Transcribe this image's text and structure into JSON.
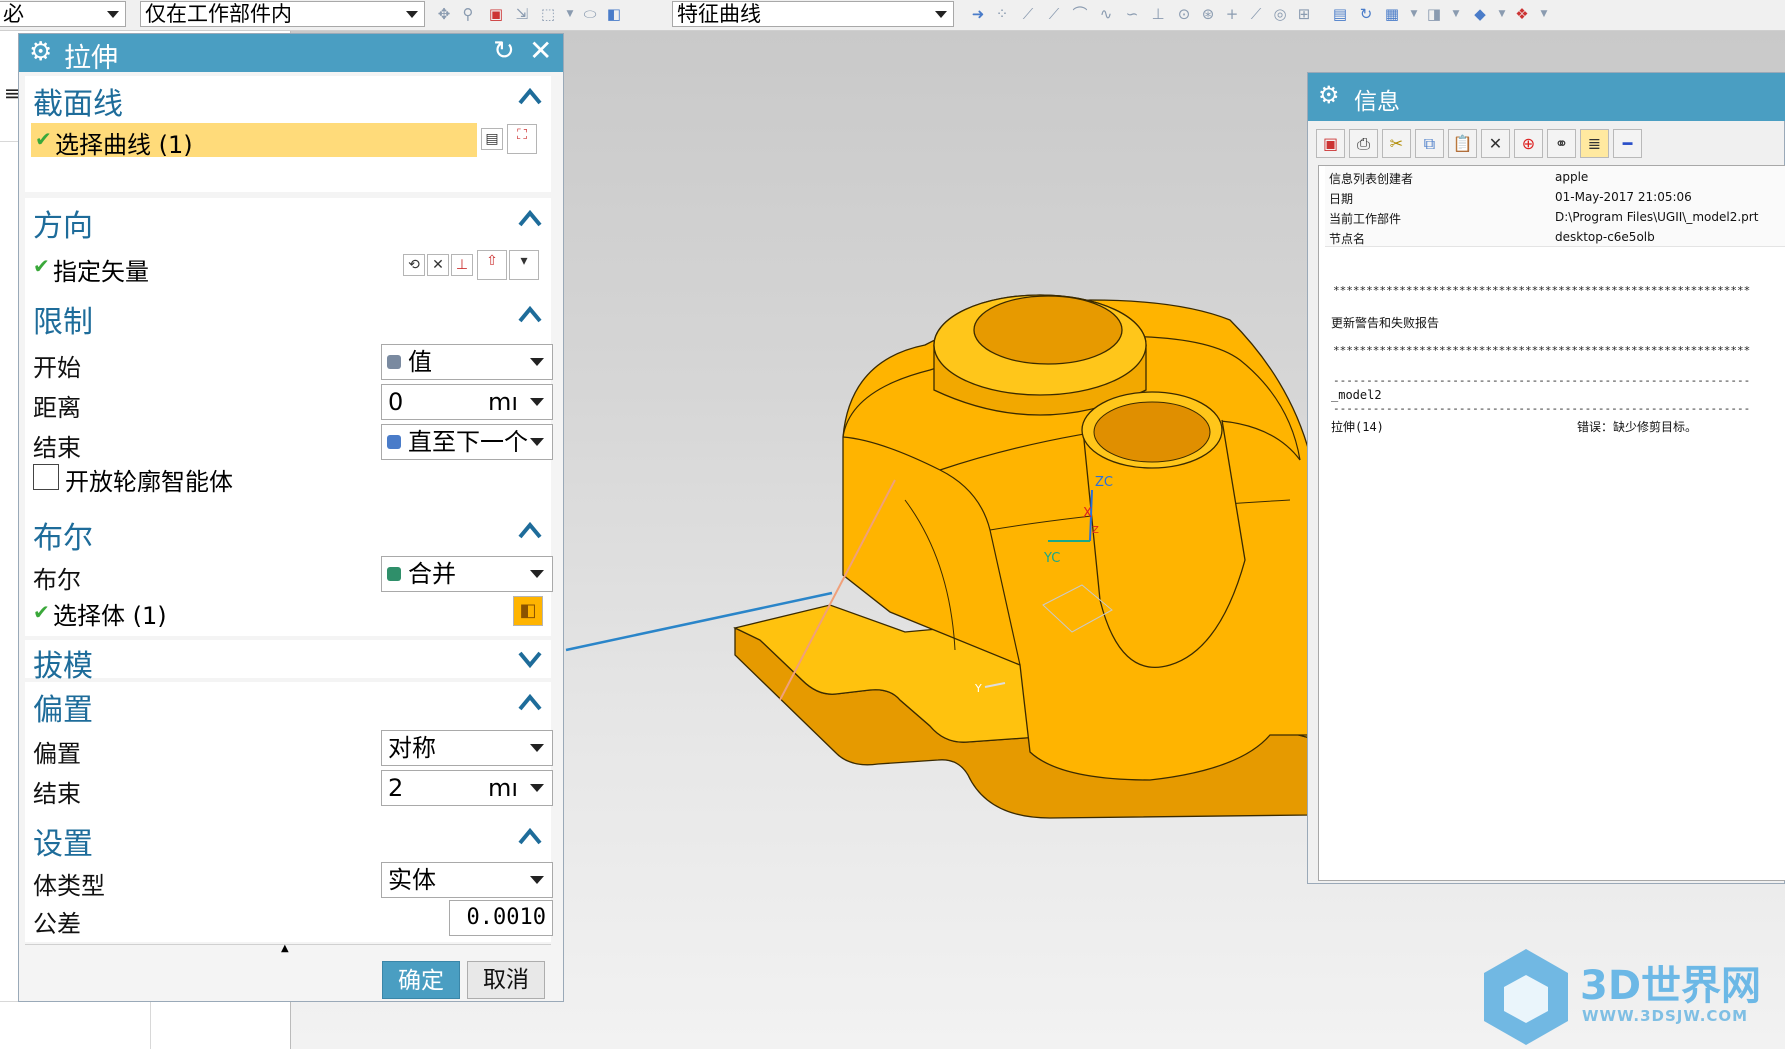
{
  "toolbar": {
    "filter_left": "必",
    "work_part_filter": "仅在工作部件内",
    "curve_rule": "特征曲线"
  },
  "dialog": {
    "title": "拉伸",
    "section_curve": {
      "title": "截面线",
      "select_curve": "选择曲线 (1)"
    },
    "direction": {
      "title": "方向",
      "specify_vector": "指定矢量"
    },
    "limits": {
      "title": "限制",
      "start_label": "开始",
      "start_value": "值",
      "distance_label": "距离",
      "distance_value": "0",
      "distance_unit": "mı",
      "end_label": "结束",
      "end_value": "直至下一个",
      "open_profile": "开放轮廓智能体"
    },
    "boolean": {
      "title": "布尔",
      "label": "布尔",
      "value": "合并",
      "select_body": "选择体 (1)"
    },
    "draft": {
      "title": "拔模"
    },
    "offset": {
      "title": "偏置",
      "label": "偏置",
      "value": "对称",
      "end_label": "结束",
      "end_value": "2",
      "end_unit": "mı"
    },
    "settings": {
      "title": "设置",
      "body_type_label": "体类型",
      "body_type_value": "实体",
      "tolerance_label": "公差",
      "tolerance_value": "0.0010"
    },
    "ok": "确定",
    "cancel": "取消"
  },
  "viewport": {
    "axis_zc": "ZC",
    "axis_yc": "YC",
    "axis_x": "X",
    "axis_z": "Z",
    "axis_y": "Y"
  },
  "info": {
    "title": "信息",
    "rows": [
      {
        "key": "信息列表创建者",
        "value": "apple"
      },
      {
        "key": "日期",
        "value": "01-May-2017 21:05:06"
      },
      {
        "key": "当前工作部件",
        "value": "D:\\Program Files\\UGII\\_model2.prt"
      },
      {
        "key": "节点名",
        "value": "desktop-c6e5olb"
      }
    ],
    "stars1": "***************************************************************",
    "report_title": "更新警告和失败报告",
    "stars2": "***************************************************************",
    "dashes1": "---------------------------------------------------------------",
    "model_name": "_model2",
    "dashes2": "---------------------------------------------------------------",
    "feature": "拉伸(14)",
    "error": "错误：缺少修剪目标。"
  },
  "watermark": {
    "brand": "3D世界网",
    "url": "WWW.3DSJW.COM"
  },
  "colors": {
    "accent": "#4a9ec2",
    "model": "#ffb400",
    "section_title": "#1e6c9a",
    "selected_row": "#ffdb7a"
  }
}
